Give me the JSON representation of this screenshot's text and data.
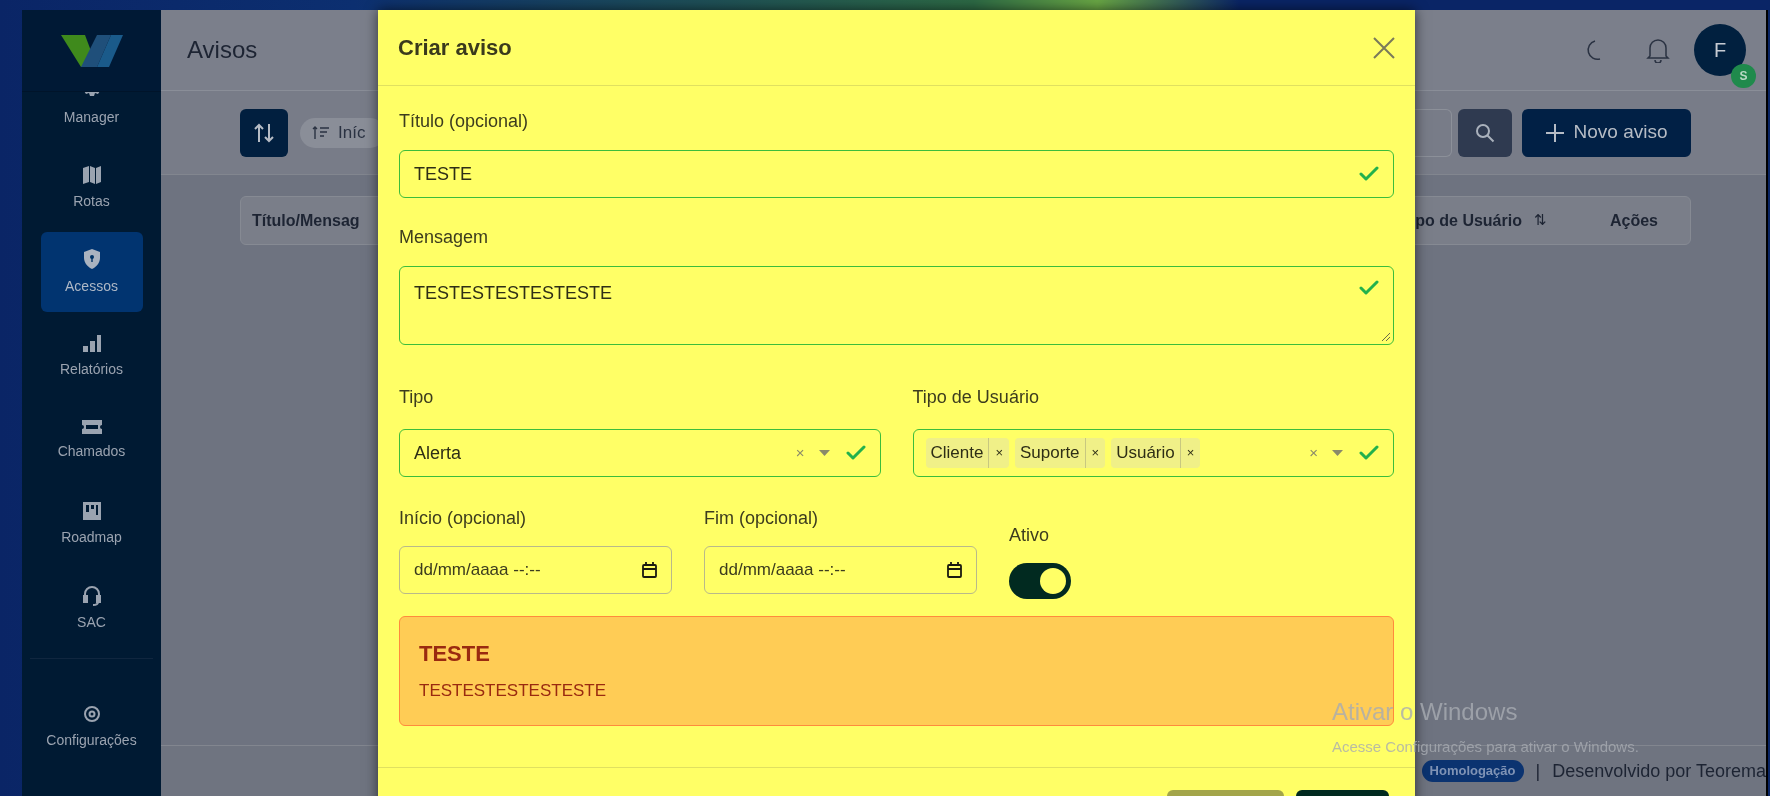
{
  "sidebar": {
    "items": [
      {
        "label": "Manager",
        "selected": false
      },
      {
        "label": "Rotas",
        "selected": false
      },
      {
        "label": "Acessos",
        "selected": true
      },
      {
        "label": "Relatórios",
        "selected": false
      },
      {
        "label": "Chamados",
        "selected": false
      },
      {
        "label": "Roadmap",
        "selected": false
      },
      {
        "label": "SAC",
        "selected": false
      }
    ],
    "footer_item": {
      "label": "Configurações",
      "selected": false
    }
  },
  "header": {
    "title": "Avisos",
    "avatar": {
      "initial": "F",
      "badge": "S"
    }
  },
  "toolbar": {
    "filter_chip": "Iníc",
    "new_button": "Novo aviso"
  },
  "table": {
    "columns": [
      "Título/Mensag",
      "po de Usuário",
      "Ações"
    ],
    "sort_icon": "⇅"
  },
  "footer": {
    "environment_badge": "Homologação",
    "separator": "|",
    "credit": "Desenvolvido por Teorema"
  },
  "modal": {
    "title": "Criar aviso",
    "fields": [
      {
        "kind": "text",
        "label": "Título (opcional)",
        "value": "TESTE",
        "valid": true
      },
      {
        "kind": "textarea",
        "label": "Mensagem",
        "value": "TESTESTESTESTESTE",
        "valid": true
      }
    ],
    "selects": [
      {
        "label": "Tipo",
        "value": "Alerta",
        "clear": "×",
        "valid": true
      },
      {
        "label": "Tipo de Usuário",
        "tags": [
          {
            "label": "Cliente",
            "remove": "×"
          },
          {
            "label": "Suporte",
            "remove": "×"
          },
          {
            "label": "Usuário",
            "remove": "×"
          }
        ],
        "clear": "×",
        "valid": true
      }
    ],
    "dates": [
      {
        "label": "Início (opcional)",
        "placeholder": "dd/mm/aaaa --:--"
      },
      {
        "label": "Fim (opcional)",
        "placeholder": "dd/mm/aaaa --:--"
      }
    ],
    "toggle": {
      "label": "Ativo",
      "on": true
    },
    "preview": {
      "kind": "alerta",
      "title": "TESTE",
      "message": "TESTESTESTESTESTE"
    }
  },
  "os_notice": {
    "title": "Ativar o Windows",
    "message": "Acesse Configurações para ativar o Windows."
  }
}
